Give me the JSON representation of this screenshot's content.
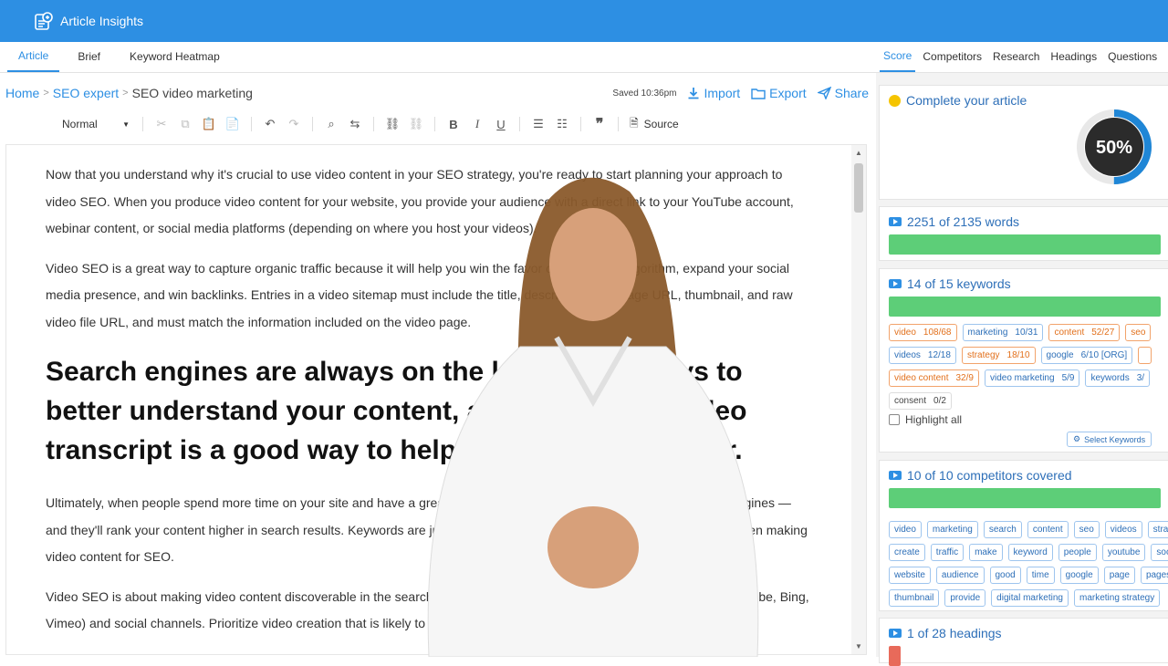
{
  "app": {
    "title": "Article Insights"
  },
  "editor_tabs": [
    "Article",
    "Brief",
    "Keyword Heatmap"
  ],
  "breadcrumb": {
    "home": "Home",
    "parent": "SEO expert",
    "current": "SEO video marketing"
  },
  "actions": {
    "saved": "Saved 10:36pm",
    "import": "Import",
    "export": "Export",
    "share": "Share"
  },
  "toolbar": {
    "format": "Normal",
    "source": "Source"
  },
  "content": {
    "p1": "Now that you understand why it's crucial to use video content in your SEO strategy, you're ready to start planning your approach to video SEO. When you produce video content for your website, you provide your audience with a direct link to your YouTube account, webinar content, or social media platforms (depending on where you host your videos).",
    "p2": "Video SEO is a great way to capture organic traffic because it will help you win the favor of the search algorithm, expand your social media presence, and win backlinks. Entries in a video sitemap must include the title, description, play page URL, thumbnail, and raw video file URL, and must match the information included on the video page.",
    "h2": "Search engines are always on the lookout for ways to better understand your content, and including a video transcript is a good way to help make their job easier.",
    "p3": "Ultimately, when people spend more time on your site and have a great experience, that sends positive signals to search engines — and they'll rank your content higher in search results. Keywords are just as important for video as text, and it's paramount when making video content for SEO.",
    "p4": "Video SEO is about making video content discoverable in the search engine results pages of search platforms (Google, YouTube, Bing, Vimeo) and social channels. Prioritize video creation that is likely to drive results in general search"
  },
  "right_tabs": [
    "Score",
    "Competitors",
    "Research",
    "Headings",
    "Questions"
  ],
  "score": {
    "title": "Complete your article",
    "percent": "50%",
    "value": 0.5,
    "accent": "#1f86d6"
  },
  "words": {
    "label": "2251 of 2135 words",
    "fill": 1.0
  },
  "keywords": {
    "label": "14 of 15 keywords",
    "fill": 1.0,
    "chips": [
      {
        "text": "video",
        "count": "108/68",
        "style": "orange"
      },
      {
        "text": "marketing",
        "count": "10/31",
        "style": "blue"
      },
      {
        "text": "content",
        "count": "52/27",
        "style": "orange"
      },
      {
        "text": "seo",
        "count": "",
        "style": "orange"
      },
      {
        "text": "videos",
        "count": "12/18",
        "style": "blue"
      },
      {
        "text": "strategy",
        "count": "18/10",
        "style": "orange"
      },
      {
        "text": "google",
        "count": "6/10 [ORG]",
        "style": "blue"
      },
      {
        "text": "",
        "count": "",
        "style": "orange"
      },
      {
        "text": "video content",
        "count": "32/9",
        "style": "orange"
      },
      {
        "text": "video marketing",
        "count": "5/9",
        "style": "blue"
      },
      {
        "text": "keywords",
        "count": "3/",
        "style": "blue"
      },
      {
        "text": "consent",
        "count": "0/2",
        "style": "grey"
      }
    ],
    "highlight": "Highlight all",
    "select": "Select Keywords"
  },
  "competitors": {
    "label": "10 of 10 competitors covered",
    "fill": 1.0,
    "chips": [
      "video",
      "marketing",
      "search",
      "content",
      "seo",
      "videos",
      "strat",
      "create",
      "traffic",
      "make",
      "keyword",
      "people",
      "youtube",
      "soc",
      "website",
      "audience",
      "good",
      "time",
      "google",
      "page",
      "pages",
      "thumbnail",
      "provide",
      "digital marketing",
      "marketing strategy"
    ]
  },
  "headings": {
    "label": "1 of 28 headings",
    "fill": 0.04
  },
  "colors": {
    "brand": "#2d8fe3",
    "bar": "#5dce78",
    "orange": "#e2701c"
  }
}
